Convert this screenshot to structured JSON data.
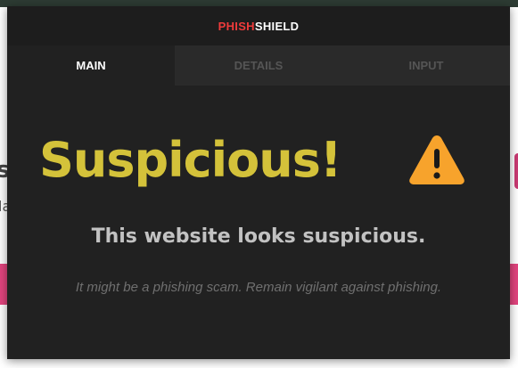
{
  "background": {
    "partial_text_1": "s",
    "partial_text_2": "la"
  },
  "header": {
    "brand_part1": "PHISH",
    "brand_part2": "SHIELD"
  },
  "tabs": [
    {
      "label": "MAIN",
      "active": true
    },
    {
      "label": "DETAILS",
      "active": false
    },
    {
      "label": "INPUT",
      "active": false
    }
  ],
  "main": {
    "headline": "Suspicious!",
    "subtitle": "This website looks suspicious.",
    "note": "It might be a phishing scam. Remain vigilant against phishing.",
    "icon": "warning-icon"
  },
  "colors": {
    "brand_red": "#ef3b3b",
    "headline_yellow": "#d4c23a",
    "warning_orange": "#f7a32c",
    "popup_bg": "#212121",
    "page_accent_pink": "#e2447e"
  }
}
